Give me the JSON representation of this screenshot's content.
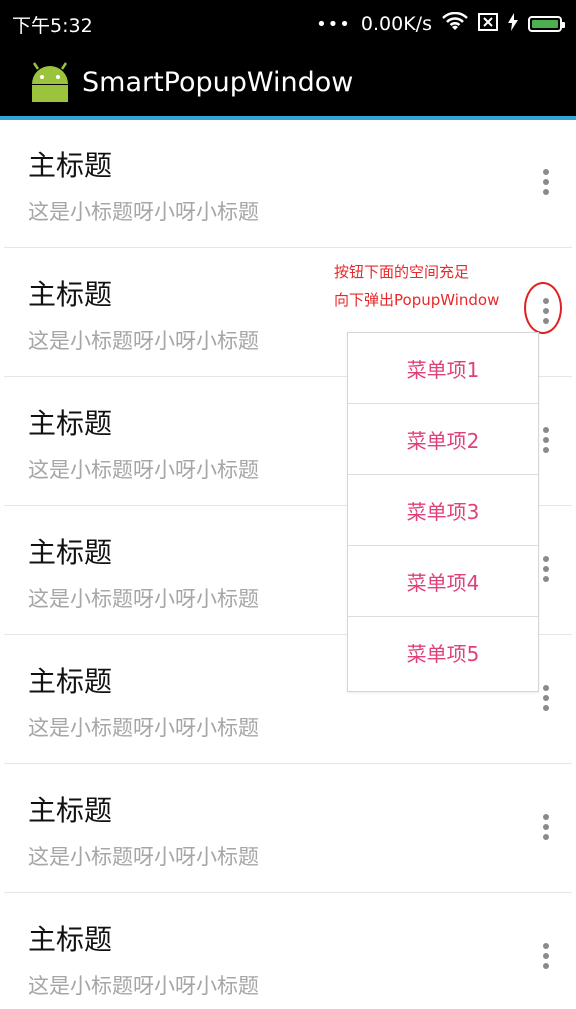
{
  "status_bar": {
    "time": "下午5:32",
    "network_speed": "0.00K/s",
    "icons": [
      "wifi-icon",
      "sim-icon",
      "charging-icon",
      "battery-icon"
    ]
  },
  "action_bar": {
    "title": "SmartPopupWindow",
    "icon": "android-icon"
  },
  "list": {
    "items": [
      {
        "title": "主标题",
        "subtitle": "这是小标题呀小呀小标题"
      },
      {
        "title": "主标题",
        "subtitle": "这是小标题呀小呀小标题"
      },
      {
        "title": "主标题",
        "subtitle": "这是小标题呀小呀小标题"
      },
      {
        "title": "主标题",
        "subtitle": "这是小标题呀小呀小标题"
      },
      {
        "title": "主标题",
        "subtitle": "这是小标题呀小呀小标题"
      },
      {
        "title": "主标题",
        "subtitle": "这是小标题呀小呀小标题"
      },
      {
        "title": "主标题",
        "subtitle": "这是小标题呀小呀小标题"
      }
    ]
  },
  "annotation": {
    "line1": "按钮下面的空间充足",
    "line2": "向下弹出PopupWindow",
    "color": "#e8282a"
  },
  "popup": {
    "items": [
      "菜单项1",
      "菜单项2",
      "菜单项3",
      "菜单项4",
      "菜单项5"
    ],
    "text_color": "#e0407c"
  }
}
